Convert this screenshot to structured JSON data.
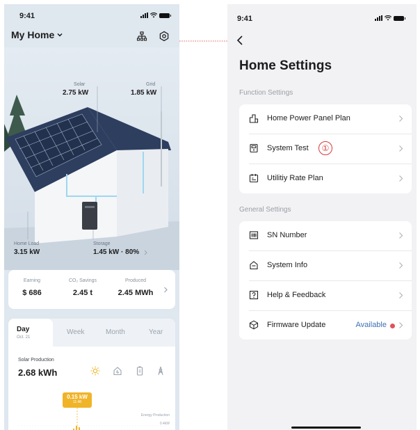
{
  "left": {
    "status_time": "9:41",
    "home_title": "My Home",
    "energy": {
      "solar_label": "Solar",
      "solar_value": "2.75 kW",
      "grid_label": "Grid",
      "grid_value": "1.85 kW",
      "home_load_label": "Home Load",
      "home_load_value": "3.15 kW",
      "storage_label": "Storage",
      "storage_value": "1.45 kW · 80%"
    },
    "stats": [
      {
        "label": "Earning",
        "value": "$ 686"
      },
      {
        "label": "CO₂ Savings",
        "value": "2.45 t"
      },
      {
        "label": "Produced",
        "value": "2.45 MWh"
      }
    ],
    "periods": {
      "day": "Day",
      "day_sub": "Oct. 21",
      "week": "Week",
      "month": "Month",
      "year": "Year"
    },
    "production": {
      "title": "Solar Production",
      "value": "2.68 kWh",
      "callout_value": "0.15 kW",
      "callout_time": "11:48",
      "legend": "Energy Production",
      "axis_label": "0.4kW"
    },
    "colors": {
      "accent": "#f0b429",
      "sky": "#dfe7ef"
    }
  },
  "right": {
    "status_time": "9:41",
    "page_title": "Home Settings",
    "function_section": "Function Settings",
    "function_items": [
      {
        "label": "Home Power Panel Plan",
        "icon": "panel-plan-icon"
      },
      {
        "label": "System Test",
        "icon": "system-test-icon",
        "annotation": "①"
      },
      {
        "label": "Utilitiy Rate Plan",
        "icon": "rate-plan-icon"
      }
    ],
    "general_section": "General Settings",
    "general_items": [
      {
        "label": "SN Number",
        "icon": "barcode-icon"
      },
      {
        "label": "System Info",
        "icon": "system-info-icon"
      },
      {
        "label": "Help & Feedback",
        "icon": "help-icon"
      },
      {
        "label": "Firmware Update",
        "icon": "firmware-icon",
        "status": "Available"
      }
    ],
    "colors": {
      "link": "#3d6fb5",
      "dot": "#e2515a",
      "annotation": "#d63a3a"
    }
  }
}
